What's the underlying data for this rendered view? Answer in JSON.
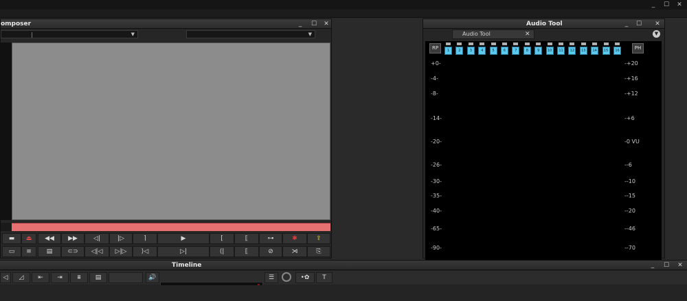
{
  "composer": {
    "title": "omposer",
    "transport_row1": [
      "▬",
      "⏏",
      "◀◀",
      "▶▶",
      "◁|",
      "|▷",
      "⌉",
      "▶",
      "[",
      "⟦",
      "⊶",
      "✱",
      "⇪"
    ],
    "transport_row2": [
      "▭",
      "≡",
      "▤",
      "⊂⊃",
      "◁|◁",
      "▷|▷",
      "⟩◁",
      "▷|",
      "⟨|",
      "⟦",
      "⊘",
      "⋊",
      "⎘"
    ]
  },
  "audio_tool": {
    "window_title": "Audio Tool",
    "tab_label": "Audio Tool",
    "rp_label": "RP",
    "ph_label": "PH",
    "channels": [
      "1",
      "2",
      "3",
      "4",
      "5",
      "6",
      "7",
      "8",
      "9",
      "10",
      "11",
      "12",
      "13",
      "14",
      "15",
      "16"
    ],
    "left_scale": [
      "+0-",
      "-4-",
      "-8-",
      "-14-",
      "-20-",
      "-26-",
      "-30-",
      "-35-",
      "-40-",
      "-65-",
      "-90-"
    ],
    "right_scale": [
      "-+20",
      "-+16",
      "-+12",
      "-+6",
      "-0 VU",
      "--6",
      "--10",
      "--15",
      "--20",
      "--46",
      "--70"
    ]
  },
  "timeline": {
    "title": "Timeline",
    "tools": [
      "◁",
      "◿",
      "⇤",
      "⇥",
      "⩩",
      "▤",
      "",
      "🔊"
    ]
  },
  "window_controls": {
    "minimize": "_",
    "maximize": "☐",
    "close": "✕"
  },
  "colors": {
    "meter_channel": "#5bc8ef",
    "trim_bar": "#e57171",
    "viewer": "#8c8c8c"
  }
}
